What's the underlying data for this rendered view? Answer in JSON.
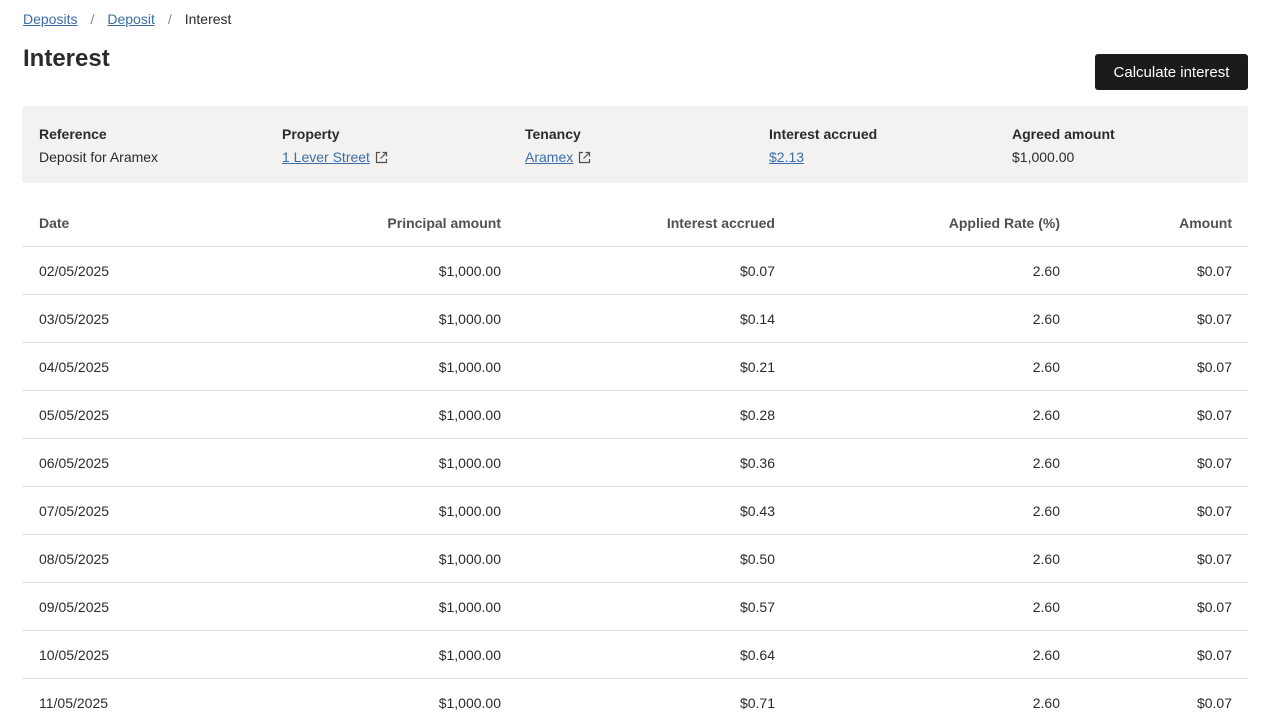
{
  "breadcrumb": {
    "items": [
      {
        "label": "Deposits"
      },
      {
        "label": "Deposit"
      }
    ],
    "current": "Interest",
    "separator": "/"
  },
  "page": {
    "title": "Interest",
    "calculate_button": "Calculate interest"
  },
  "summary": {
    "reference": {
      "label": "Reference",
      "value": "Deposit for Aramex"
    },
    "property": {
      "label": "Property",
      "value": "1 Lever Street",
      "icon": "external-link-icon"
    },
    "tenancy": {
      "label": "Tenancy",
      "value": "Aramex",
      "icon": "external-link-icon"
    },
    "interest_accrued": {
      "label": "Interest accrued",
      "value": "$2.13"
    },
    "agreed_amount": {
      "label": "Agreed amount",
      "value": "$1,000.00"
    }
  },
  "table": {
    "headers": {
      "date": "Date",
      "principal": "Principal amount",
      "interest": "Interest accrued",
      "rate": "Applied Rate (%)",
      "amount": "Amount"
    },
    "rows": [
      {
        "date": "02/05/2025",
        "principal": "$1,000.00",
        "interest": "$0.07",
        "rate": "2.60",
        "amount": "$0.07"
      },
      {
        "date": "03/05/2025",
        "principal": "$1,000.00",
        "interest": "$0.14",
        "rate": "2.60",
        "amount": "$0.07"
      },
      {
        "date": "04/05/2025",
        "principal": "$1,000.00",
        "interest": "$0.21",
        "rate": "2.60",
        "amount": "$0.07"
      },
      {
        "date": "05/05/2025",
        "principal": "$1,000.00",
        "interest": "$0.28",
        "rate": "2.60",
        "amount": "$0.07"
      },
      {
        "date": "06/05/2025",
        "principal": "$1,000.00",
        "interest": "$0.36",
        "rate": "2.60",
        "amount": "$0.07"
      },
      {
        "date": "07/05/2025",
        "principal": "$1,000.00",
        "interest": "$0.43",
        "rate": "2.60",
        "amount": "$0.07"
      },
      {
        "date": "08/05/2025",
        "principal": "$1,000.00",
        "interest": "$0.50",
        "rate": "2.60",
        "amount": "$0.07"
      },
      {
        "date": "09/05/2025",
        "principal": "$1,000.00",
        "interest": "$0.57",
        "rate": "2.60",
        "amount": "$0.07"
      },
      {
        "date": "10/05/2025",
        "principal": "$1,000.00",
        "interest": "$0.64",
        "rate": "2.60",
        "amount": "$0.07"
      },
      {
        "date": "11/05/2025",
        "principal": "$1,000.00",
        "interest": "$0.71",
        "rate": "2.60",
        "amount": "$0.07"
      }
    ]
  },
  "colors": {
    "link": "#3b6ea8",
    "button_bg": "#1b1b1b",
    "summary_bg": "#f3f2f1",
    "divider": "#e1dfdd"
  }
}
